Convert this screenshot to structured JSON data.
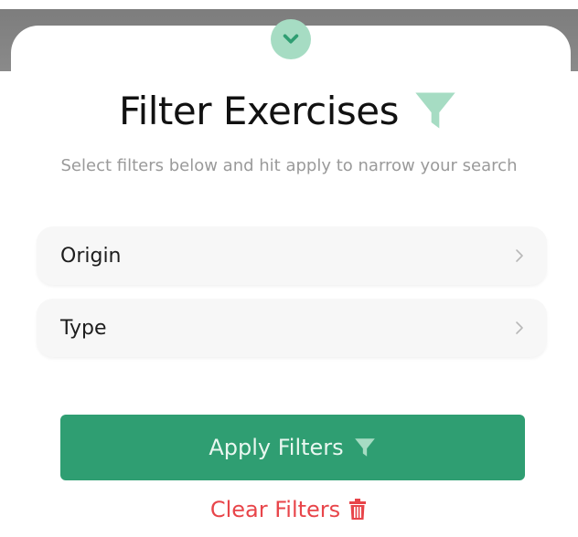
{
  "sheet": {
    "title": "Filter Exercises",
    "subtitle": "Select filters below and hit apply to narrow your search",
    "handle_icon": "chevron-down-icon",
    "title_icon": "filter-icon"
  },
  "filters": [
    {
      "label": "Origin",
      "icon": "chevron-right-icon"
    },
    {
      "label": "Type",
      "icon": "chevron-right-icon"
    }
  ],
  "actions": {
    "apply_label": "Apply Filters",
    "apply_icon": "filter-icon",
    "clear_label": "Clear Filters",
    "clear_icon": "trash-icon"
  },
  "colors": {
    "accent": "#2f9e72",
    "accent_light": "#a6dcc3",
    "danger": "#e8454a"
  }
}
